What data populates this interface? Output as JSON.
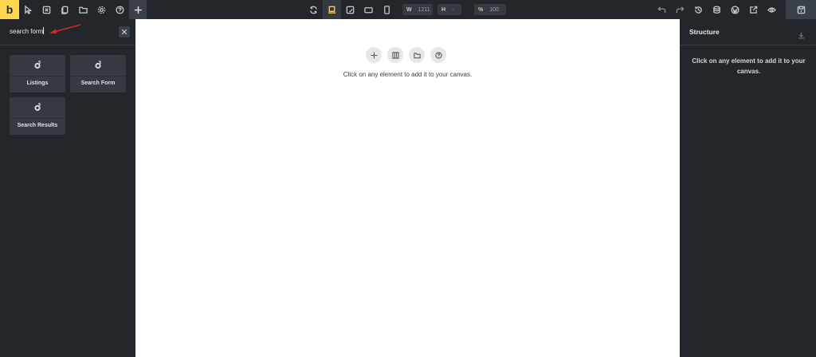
{
  "toolbar": {
    "logo": "b",
    "width_label": "W",
    "width_value": "1211",
    "height_label": "H",
    "height_value": "-",
    "zoom_label": "%",
    "zoom_value": "100"
  },
  "left_panel": {
    "search_value": "search form",
    "elements": [
      {
        "label": "Listings"
      },
      {
        "label": "Search Form"
      },
      {
        "label": "Search Results"
      }
    ]
  },
  "canvas": {
    "hint": "Click on any element to add it to your canvas."
  },
  "right_panel": {
    "title": "Structure",
    "hint": "Click on any element to add it to your canvas."
  },
  "colors": {
    "accent": "#ffd64f",
    "panel_bg": "#23272b",
    "tile_bg": "#343a40",
    "annotation_arrow": "#d9261c"
  }
}
